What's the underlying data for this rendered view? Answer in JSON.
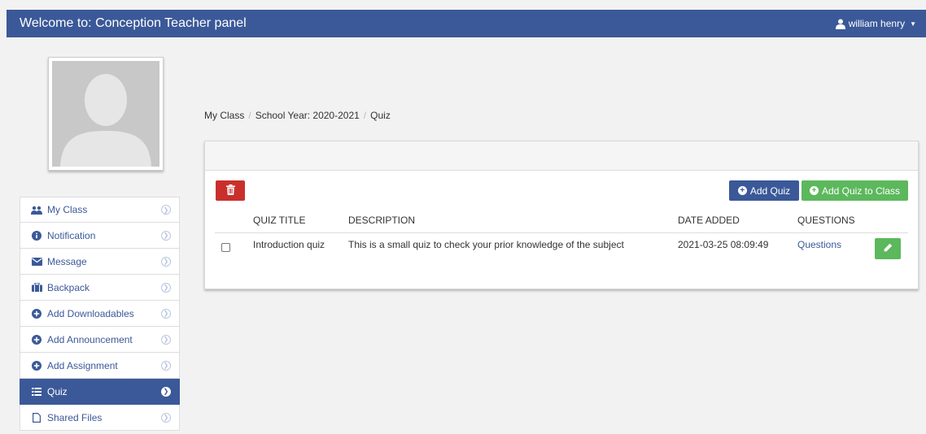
{
  "header": {
    "title": "Welcome to: Conception Teacher panel",
    "user_name": "william henry",
    "user_icon": "user-icon",
    "brand_color": "#3b5998"
  },
  "sidebar": {
    "items": [
      {
        "label": "My Class",
        "icon": "users-icon"
      },
      {
        "label": "Notification",
        "icon": "info-icon"
      },
      {
        "label": "Message",
        "icon": "envelope-icon"
      },
      {
        "label": "Backpack",
        "icon": "briefcase-icon"
      },
      {
        "label": "Add Downloadables",
        "icon": "plus-circle-icon"
      },
      {
        "label": "Add Announcement",
        "icon": "plus-circle-icon"
      },
      {
        "label": "Add Assignment",
        "icon": "plus-circle-icon"
      },
      {
        "label": "Quiz",
        "icon": "list-icon",
        "active": true
      },
      {
        "label": "Shared Files",
        "icon": "file-icon"
      }
    ]
  },
  "breadcrumb": {
    "items": [
      "My Class",
      "School Year: 2020-2021",
      "Quiz"
    ]
  },
  "toolbar": {
    "add_quiz_label": "Add Quiz",
    "add_quiz_to_class_label": "Add Quiz to Class",
    "delete_icon": "trash-icon",
    "danger_color": "#c9302c",
    "success_color": "#5cb85c"
  },
  "table": {
    "columns": [
      "QUIZ TITLE",
      "DESCRIPTION",
      "DATE ADDED",
      "QUESTIONS"
    ],
    "rows": [
      {
        "title": "Introduction quiz",
        "description": "This is a small quiz to check your prior knowledge of the subject",
        "date_added": "2021-03-25 08:09:49",
        "questions_link": "Questions",
        "edit_icon": "pencil-icon"
      }
    ]
  }
}
